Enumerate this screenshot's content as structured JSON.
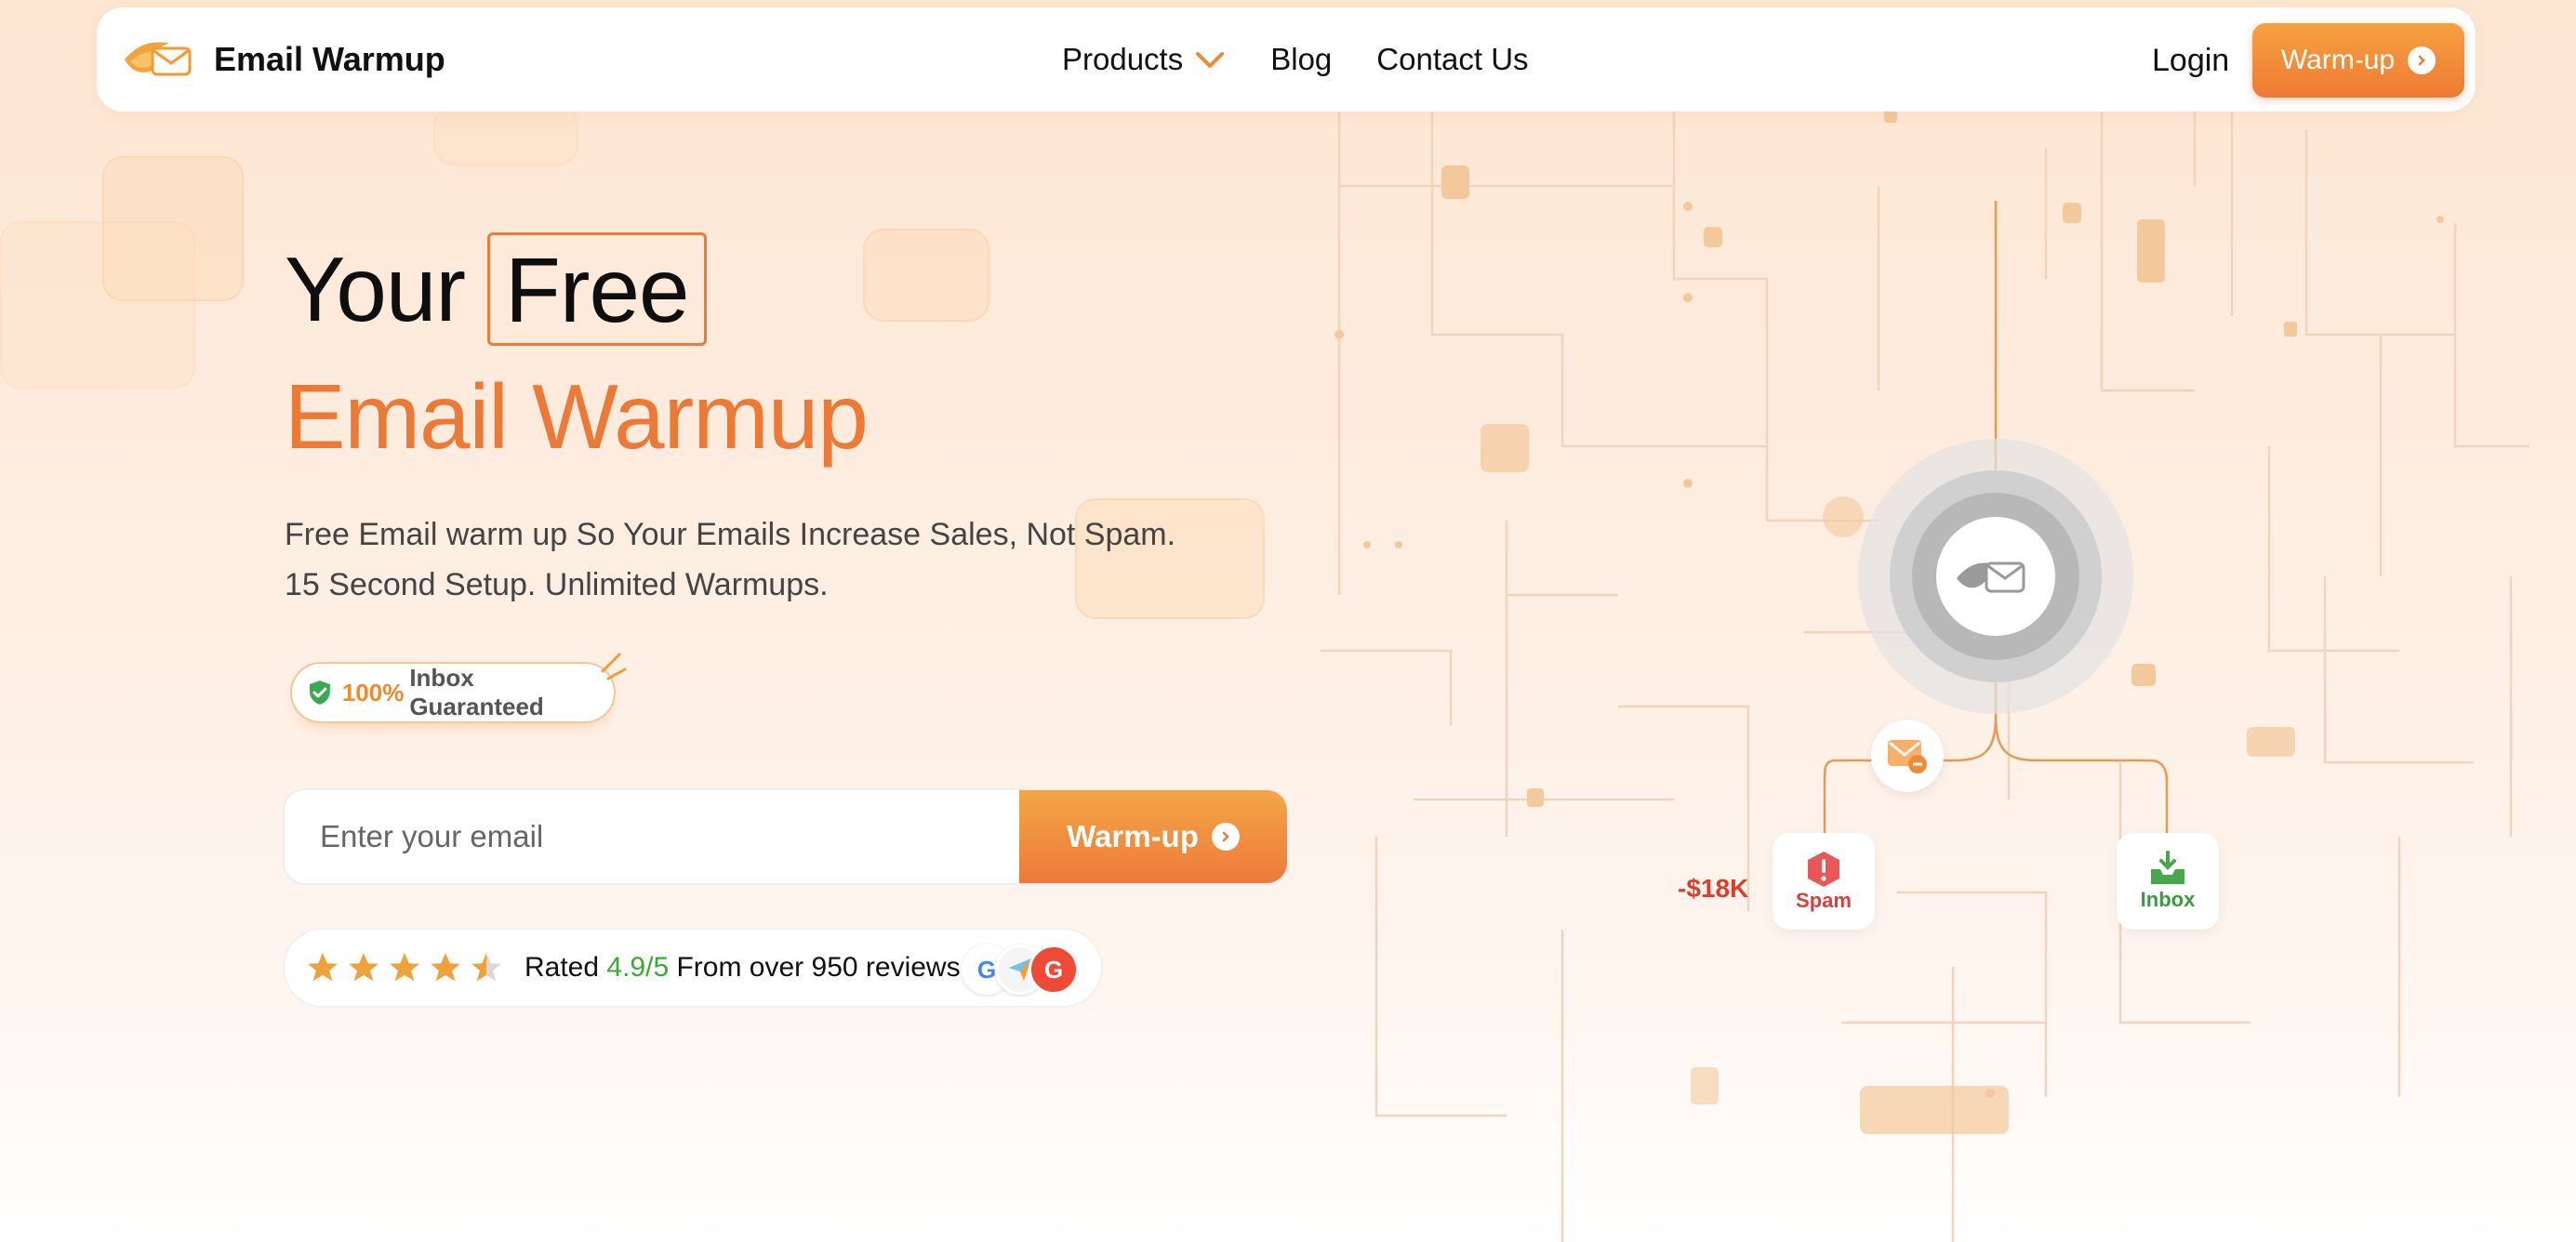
{
  "nav": {
    "brand": "Email Warmup",
    "links": [
      {
        "label": "Products",
        "has_dropdown": true
      },
      {
        "label": "Blog"
      },
      {
        "label": "Contact Us"
      }
    ],
    "login": "Login",
    "cta": "Warm-up"
  },
  "hero": {
    "title_line1_prefix": "Your",
    "title_line1_boxed": "Free",
    "title_line2": "Email Warmup",
    "subtitle_line1": "Free Email warm up So Your Emails Increase Sales, Not Spam.",
    "subtitle_line2": "15 Second Setup. Unlimited Warmups.",
    "badge": {
      "percent": "100%",
      "text": "Inbox Guaranteed"
    },
    "email_form": {
      "placeholder": "Enter your email",
      "button": "Warm-up"
    },
    "rating": {
      "stars": 4.5,
      "prefix": "Rated",
      "score": "4.9/5",
      "suffix": "From over 950 reviews"
    }
  },
  "diagram": {
    "spam_label": "Spam",
    "inbox_label": "Inbox",
    "loss_label": "-$18K"
  },
  "colors": {
    "accent": "#ec7a36",
    "spam": "#d84040",
    "inbox": "#3a9b3e",
    "rating_score": "#3aaa35"
  }
}
